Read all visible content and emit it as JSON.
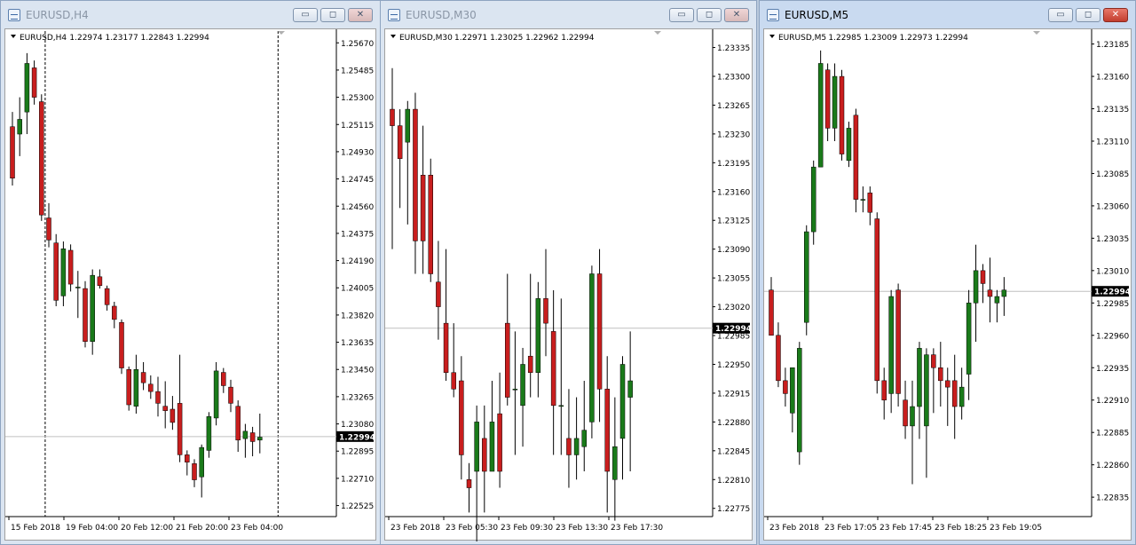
{
  "colors": {
    "bull": "#1a7a1a",
    "bear": "#c81e1e",
    "wick": "#000000",
    "price_line": "#c0c0c0",
    "price_tag_bg": "#000000",
    "price_tag_fg": "#ffffff"
  },
  "windows": [
    {
      "title": "EURUSD,H4",
      "active": false,
      "header": {
        "symbol": "EURUSD,H4",
        "quote": "1.22974 1.23177 1.22843 1.22994"
      },
      "buttons": {
        "minimize": "▭",
        "maximize": "◻",
        "close": "✕"
      },
      "chart_data": {
        "type": "candlestick",
        "symbol": "EURUSD",
        "timeframe": "H4",
        "ylim": [
          1.2245,
          1.2575
        ],
        "y_ticks": [
          "1.25670",
          "1.25485",
          "1.25300",
          "1.25115",
          "1.24930",
          "1.24745",
          "1.24560",
          "1.24375",
          "1.24190",
          "1.24005",
          "1.23820",
          "1.23635",
          "1.23450",
          "1.23265",
          "1.23080",
          "1.22895",
          "1.22710",
          "1.22525"
        ],
        "x_ticks": [
          "15 Feb 2018",
          "19 Feb 04:00",
          "20 Feb 12:00",
          "21 Feb 20:00",
          "23 Feb 04:00"
        ],
        "current_price": "1.22994",
        "candles": [
          [
            1.251,
            1.252,
            1.247,
            1.2475
          ],
          [
            1.2505,
            1.253,
            1.249,
            1.2515
          ],
          [
            1.252,
            1.256,
            1.2505,
            1.2553
          ],
          [
            1.255,
            1.2555,
            1.2525,
            1.253
          ],
          [
            1.2527,
            1.2532,
            1.2446,
            1.245
          ],
          [
            1.2448,
            1.2458,
            1.2428,
            1.2433
          ],
          [
            1.2431,
            1.2437,
            1.2388,
            1.2392
          ],
          [
            1.2395,
            1.2432,
            1.2388,
            1.2427
          ],
          [
            1.2426,
            1.243,
            1.2398,
            1.2403
          ],
          [
            1.2401,
            1.2412,
            1.238,
            1.2401
          ],
          [
            1.24,
            1.2405,
            1.236,
            1.2364
          ],
          [
            1.2364,
            1.2413,
            1.2355,
            1.2409
          ],
          [
            1.2408,
            1.2413,
            1.24,
            1.2402
          ],
          [
            1.24,
            1.2402,
            1.2385,
            1.2389
          ],
          [
            1.2388,
            1.2391,
            1.2373,
            1.2379
          ],
          [
            1.2377,
            1.2379,
            1.2342,
            1.2346
          ],
          [
            1.2345,
            1.2347,
            1.2317,
            1.2321
          ],
          [
            1.232,
            1.2355,
            1.2315,
            1.2345
          ],
          [
            1.2343,
            1.235,
            1.2331,
            1.2336
          ],
          [
            1.2335,
            1.2341,
            1.2325,
            1.233
          ],
          [
            1.233,
            1.234,
            1.2313,
            1.2322
          ],
          [
            1.232,
            1.2337,
            1.2305,
            1.2317
          ],
          [
            1.2318,
            1.2327,
            1.2304,
            1.2309
          ],
          [
            1.2322,
            1.2355,
            1.2282,
            1.2287
          ],
          [
            1.2287,
            1.229,
            1.2273,
            1.2282
          ],
          [
            1.2281,
            1.2284,
            1.2265,
            1.227
          ],
          [
            1.2272,
            1.2294,
            1.2258,
            1.2292
          ],
          [
            1.229,
            1.2316,
            1.2285,
            1.2313
          ],
          [
            1.2312,
            1.235,
            1.2307,
            1.2344
          ],
          [
            1.2343,
            1.2346,
            1.2329,
            1.2334
          ],
          [
            1.2333,
            1.2338,
            1.2316,
            1.2322
          ],
          [
            1.232,
            1.2324,
            1.2289,
            1.2297
          ],
          [
            1.2298,
            1.2308,
            1.2285,
            1.2303
          ],
          [
            1.2302,
            1.2306,
            1.2286,
            1.2296
          ],
          [
            1.2297,
            1.2315,
            1.2288,
            1.2299
          ]
        ],
        "period_separators": [
          5,
          37
        ]
      }
    },
    {
      "title": "EURUSD,M30",
      "active": false,
      "header": {
        "symbol": "EURUSD,M30",
        "quote": "1.22971 1.23025 1.22962 1.22994"
      },
      "buttons": {
        "minimize": "▭",
        "maximize": "◻",
        "close": "✕"
      },
      "chart_data": {
        "type": "candlestick",
        "symbol": "EURUSD",
        "timeframe": "M30",
        "ylim": [
          1.22765,
          1.23355
        ],
        "y_ticks": [
          "1.23335",
          "1.23300",
          "1.23265",
          "1.23230",
          "1.23195",
          "1.23160",
          "1.23125",
          "1.23090",
          "1.23055",
          "1.23020",
          "1.22985",
          "1.22950",
          "1.22915",
          "1.22880",
          "1.22845",
          "1.22810",
          "1.22775"
        ],
        "x_ticks": [
          "23 Feb 2018",
          "23 Feb 05:30",
          "23 Feb 09:30",
          "23 Feb 13:30",
          "23 Feb 17:30"
        ],
        "current_price": "1.22994",
        "candles": [
          [
            1.2326,
            1.2331,
            1.2309,
            1.2324
          ],
          [
            1.2324,
            1.2326,
            1.2314,
            1.232
          ],
          [
            1.2322,
            1.2327,
            1.2312,
            1.2326
          ],
          [
            1.2326,
            1.2328,
            1.2306,
            1.231
          ],
          [
            1.2318,
            1.2324,
            1.2306,
            1.231
          ],
          [
            1.2318,
            1.232,
            1.2305,
            1.2306
          ],
          [
            1.2305,
            1.231,
            1.2298,
            1.2302
          ],
          [
            1.23,
            1.2309,
            1.2293,
            1.2294
          ],
          [
            1.2294,
            1.23,
            1.2291,
            1.2292
          ],
          [
            1.2293,
            1.2296,
            1.2281,
            1.2284
          ],
          [
            1.2281,
            1.2283,
            1.2277,
            1.228
          ],
          [
            1.2282,
            1.229,
            1.2272,
            1.2288
          ],
          [
            1.2286,
            1.229,
            1.2277,
            1.2282
          ],
          [
            1.2282,
            1.2293,
            1.2282,
            1.2288
          ],
          [
            1.2289,
            1.2294,
            1.228,
            1.2282
          ],
          [
            1.23,
            1.2306,
            1.229,
            1.2291
          ],
          [
            1.2292,
            1.2299,
            1.2284,
            1.2292
          ],
          [
            1.229,
            1.2297,
            1.2285,
            1.2295
          ],
          [
            1.2296,
            1.2306,
            1.2291,
            1.2294
          ],
          [
            1.2294,
            1.2305,
            1.2291,
            1.2303
          ],
          [
            1.2303,
            1.2309,
            1.2296,
            1.23
          ],
          [
            1.2299,
            1.2304,
            1.2284,
            1.229
          ],
          [
            1.229,
            1.2303,
            1.2284,
            1.229
          ],
          [
            1.2286,
            1.2292,
            1.228,
            1.2284
          ],
          [
            1.2284,
            1.2291,
            1.2281,
            1.2286
          ],
          [
            1.2285,
            1.2293,
            1.2282,
            1.2287
          ],
          [
            1.2288,
            1.2307,
            1.2286,
            1.2306
          ],
          [
            1.2306,
            1.2309,
            1.2288,
            1.2292
          ],
          [
            1.2292,
            1.2296,
            1.2277,
            1.2282
          ],
          [
            1.2281,
            1.2291,
            1.2276,
            1.2285
          ],
          [
            1.2286,
            1.2296,
            1.2281,
            1.2295
          ],
          [
            1.2291,
            1.2299,
            1.2282,
            1.2293
          ]
        ],
        "period_separators": [
          53
        ]
      }
    },
    {
      "title": "EURUSD,M5",
      "active": true,
      "header": {
        "symbol": "EURUSD,M5",
        "quote": "1.22985 1.23009 1.22973 1.22994"
      },
      "buttons": {
        "minimize": "▭",
        "maximize": "◻",
        "close": "✕"
      },
      "chart_data": {
        "type": "candlestick",
        "symbol": "EURUSD",
        "timeframe": "M5",
        "ylim": [
          1.2282,
          1.23195
        ],
        "y_ticks": [
          "1.23185",
          "1.23160",
          "1.23135",
          "1.23110",
          "1.23085",
          "1.23060",
          "1.23035",
          "1.23010",
          "1.22985",
          "1.22960",
          "1.22935",
          "1.22910",
          "1.22885",
          "1.22860",
          "1.22835"
        ],
        "x_ticks": [
          "23 Feb 2018",
          "23 Feb 17:05",
          "23 Feb 17:45",
          "23 Feb 18:25",
          "23 Feb 19:05"
        ],
        "current_price": "1.22994",
        "candles": [
          [
            1.22995,
            1.23005,
            1.2296,
            1.2296
          ],
          [
            1.2296,
            1.2297,
            1.2292,
            1.22925
          ],
          [
            1.22925,
            1.22935,
            1.22905,
            1.22915
          ],
          [
            1.229,
            1.2292,
            1.22885,
            1.22935
          ],
          [
            1.2287,
            1.22955,
            1.2286,
            1.2295
          ],
          [
            1.2297,
            1.23045,
            1.2296,
            1.2304
          ],
          [
            1.2304,
            1.23095,
            1.2303,
            1.2309
          ],
          [
            1.2309,
            1.2318,
            1.2309,
            1.2317
          ],
          [
            1.23165,
            1.2317,
            1.2311,
            1.2312
          ],
          [
            1.2312,
            1.2317,
            1.2311,
            1.2316
          ],
          [
            1.2316,
            1.23165,
            1.23095,
            1.231
          ],
          [
            1.23095,
            1.23125,
            1.2309,
            1.2312
          ],
          [
            1.2313,
            1.23135,
            1.23055,
            1.23065
          ],
          [
            1.23065,
            1.23075,
            1.23055,
            1.23065
          ],
          [
            1.2307,
            1.23075,
            1.23045,
            1.23055
          ],
          [
            1.2305,
            1.23055,
            1.22915,
            1.22925
          ],
          [
            1.22925,
            1.22935,
            1.22895,
            1.2291
          ],
          [
            1.22915,
            1.22995,
            1.229,
            1.2299
          ],
          [
            1.22995,
            1.23,
            1.22905,
            1.22915
          ],
          [
            1.2291,
            1.22925,
            1.2288,
            1.2289
          ],
          [
            1.2289,
            1.22925,
            1.22845,
            1.22905
          ],
          [
            1.22905,
            1.22955,
            1.2288,
            1.2295
          ],
          [
            1.2289,
            1.2295,
            1.2285,
            1.22945
          ],
          [
            1.22945,
            1.2295,
            1.229,
            1.22935
          ],
          [
            1.22935,
            1.22955,
            1.22905,
            1.22925
          ],
          [
            1.22925,
            1.22935,
            1.2289,
            1.2292
          ],
          [
            1.22925,
            1.22945,
            1.2288,
            1.22905
          ],
          [
            1.22905,
            1.22935,
            1.22895,
            1.2292
          ],
          [
            1.2293,
            1.22995,
            1.2291,
            1.22985
          ],
          [
            1.22985,
            1.2303,
            1.22955,
            1.2301
          ],
          [
            1.2301,
            1.23015,
            1.22985,
            1.23
          ],
          [
            1.22995,
            1.2302,
            1.2297,
            1.2299
          ],
          [
            1.22985,
            1.22995,
            1.2297,
            1.2299
          ],
          [
            1.2299,
            1.23005,
            1.22975,
            1.22995
          ]
        ],
        "period_separators": []
      }
    }
  ]
}
